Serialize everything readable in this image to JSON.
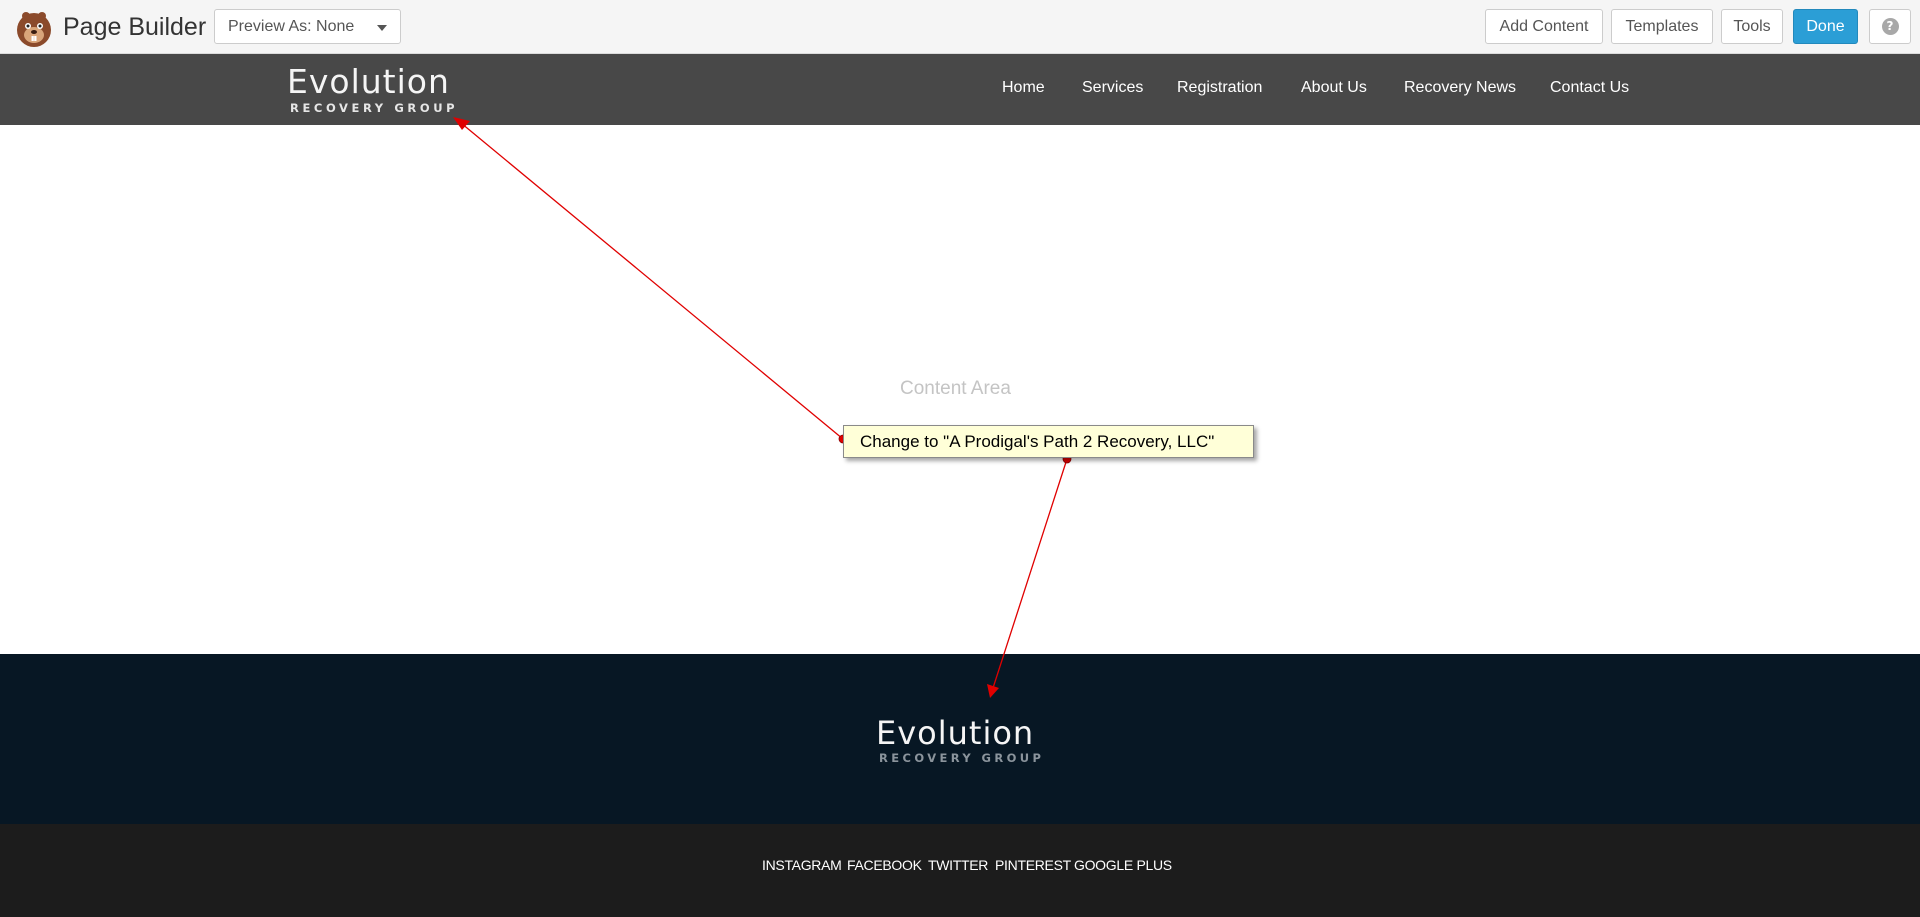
{
  "builder": {
    "title": "Page Builder",
    "logo_icon": "beaver-logo-icon",
    "preview_select": {
      "value": "Preview As: None",
      "icon": "caret-down-icon"
    },
    "buttons": {
      "add_content": "Add Content",
      "templates": "Templates",
      "tools": "Tools",
      "done": "Done"
    },
    "help_icon": "help-icon",
    "help_glyph": "?"
  },
  "site": {
    "logo": {
      "main": "Evolution",
      "sub": "RECOVERY GROUP"
    },
    "nav": [
      "Home",
      "Services",
      "Registration",
      "About Us",
      "Recovery News",
      "Contact Us"
    ]
  },
  "content": {
    "placeholder": "Content Area"
  },
  "annotation": {
    "note": "Change to \"A Prodigal's Path 2 Recovery, LLC\""
  },
  "footer": {
    "logo": {
      "main": "Evolution",
      "sub": "RECOVERY GROUP"
    },
    "social": [
      "INSTAGRAM",
      "FACEBOOK",
      "TWITTER",
      "PINTEREST",
      "GOOGLE PLUS"
    ]
  },
  "colors": {
    "builder_bar": "#f5f5f5",
    "header": "#484848",
    "footer_main": "#071724",
    "footer_bottom": "#1c1c1c",
    "done_button": "#2b9ed6",
    "note_fill": "#ffffd8",
    "arrow": "#e00000"
  }
}
